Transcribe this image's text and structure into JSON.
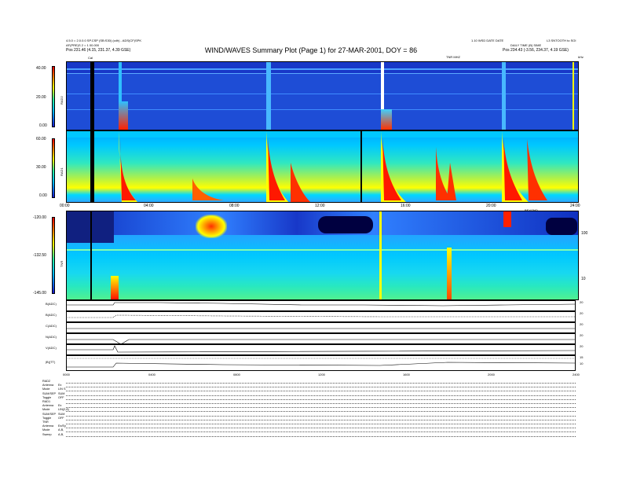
{
  "header": {
    "left_line1": "4.5.0 = 2.0.0.0 SP.CSP (SB:S30) (cdh) - ADS(CF)SPK",
    "left_line2": "AF(PRE)S 2 = 1 00.000",
    "left_line3": "Pos   231.46 (4.15, 231.37, 4.39 GSE)",
    "right_line1": "1.10 WSD DATE DATE",
    "right_line2": "DAILY TIME (B) SIME",
    "right_line3": "Pos   234.43 (-3.56, 234.37, 4.19 GSE)",
    "right_corner": "L3 SNTOOTH to SOI",
    "title": "WIND/WAVES Summary Plot (Page 1) for 27-MAR-2001, DOY = 86",
    "cal_marker": "Cal",
    "tnr_tag": "TNR MHZ",
    "khz_tag": "kHz"
  },
  "panels": {
    "rad2": {
      "label": "RAD2",
      "ticks": [
        "40.00",
        "20.00",
        "0.00"
      ]
    },
    "rad1": {
      "label": "RAD1",
      "ticks": [
        "60.00",
        "30.00",
        "0.00"
      ]
    },
    "tnr": {
      "label": "TNR",
      "ticks": [
        "-120.00",
        "-132.50",
        "-145.00"
      ],
      "right_ticks": [
        "100",
        "10"
      ],
      "right_tag": "BEYOND"
    }
  },
  "time_axis_top": [
    "00:00",
    "04:00",
    "08:00",
    "12:00",
    "16:00",
    "20:00",
    "24:00"
  ],
  "time_axis_bottom": [
    "0000",
    "0400",
    "0800",
    "1200",
    "1600",
    "2000",
    "2400"
  ],
  "mag_strips": [
    {
      "label": "B(ADC)",
      "ticks": [
        "20",
        "0"
      ]
    },
    {
      "label": "B(ADC)",
      "ticks": [
        "20",
        "0"
      ]
    },
    {
      "label": "C(ADC)",
      "ticks": [
        "20",
        "0"
      ]
    },
    {
      "label": "N(ADC)",
      "ticks": [
        "20",
        "0"
      ]
    },
    {
      "label": "V(ADC)",
      "ticks": [
        "20",
        "0"
      ]
    },
    {
      "label": "|B|(TT)",
      "ticks": [
        "15",
        "10",
        "0"
      ]
    }
  ],
  "footer": [
    {
      "k": "RAD2",
      "v": ""
    },
    {
      "k": "Antenna",
      "v": "Ex"
    },
    {
      "k": "Mode",
      "v": "LIN S"
    },
    {
      "k": "SUM/SEP",
      "v": "SUM"
    },
    {
      "k": "Toggle",
      "v": "OFF"
    },
    {
      "k": "RAD1",
      "v": ""
    },
    {
      "k": "Antenna",
      "v": "Ex"
    },
    {
      "k": "Mode",
      "v": "LIN(2,8)"
    },
    {
      "k": "SUM/SEP",
      "v": "SUM"
    },
    {
      "k": "Toggle",
      "v": "OFF"
    },
    {
      "k": "TNR",
      "v": ""
    },
    {
      "k": "Antenna",
      "v": "Ex/Ey"
    },
    {
      "k": "Mode",
      "v": "A,B,"
    },
    {
      "k": "Sweep",
      "v": "A,B,"
    }
  ],
  "colors": {
    "deep_blue": "#1a1ad0",
    "blue": "#1e4dd6",
    "cyan": "#00b8ff",
    "green": "#28f0a0",
    "yellow": "#ffff00",
    "orange": "#ff8000",
    "red": "#ff0000"
  },
  "chart_data": {
    "type": "heatmap",
    "title": "WIND/WAVES Summary Plot (Page 1) for 27-MAR-2001, DOY = 86",
    "x_range_hours": [
      0,
      24
    ],
    "x_ticks": [
      "00:00",
      "04:00",
      "08:00",
      "12:00",
      "16:00",
      "20:00",
      "24:00"
    ],
    "panels": [
      {
        "name": "RAD2",
        "ylim": [
          0,
          40
        ]
      },
      {
        "name": "RAD1",
        "ylim": [
          0,
          60
        ]
      },
      {
        "name": "TNR",
        "ylim": [
          -145,
          -120
        ]
      }
    ],
    "bursts_hours": [
      2.6,
      6.2,
      9.4,
      10.6,
      14.6,
      16.8,
      20.6,
      21.4
    ],
    "colorscale": [
      "#1a1ad0",
      "#00b8ff",
      "#28f0a0",
      "#ffff00",
      "#ff8000",
      "#ff0000"
    ]
  }
}
